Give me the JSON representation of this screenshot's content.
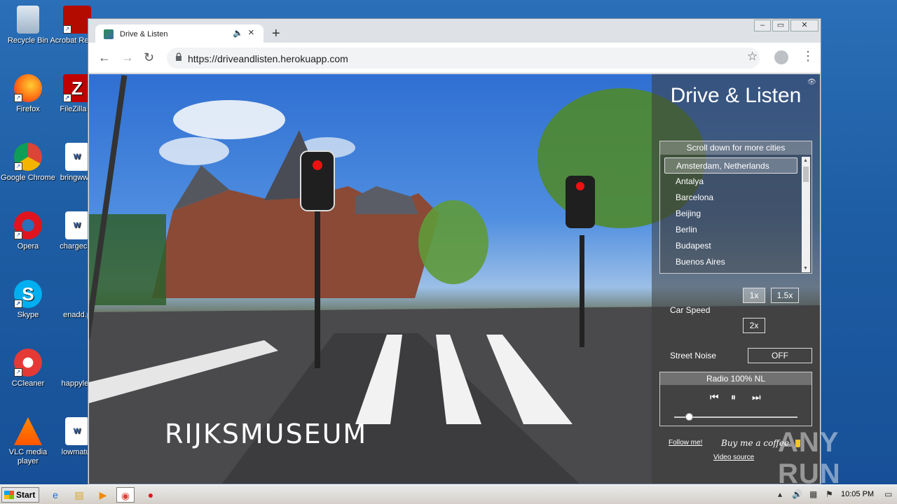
{
  "desktop": {
    "icons": [
      {
        "label": "Recycle Bin"
      },
      {
        "label": "Acrobat Reader"
      },
      {
        "label": "Firefox"
      },
      {
        "label": "FileZilla C"
      },
      {
        "label": "Google Chrome"
      },
      {
        "label": "bringwww"
      },
      {
        "label": "Opera"
      },
      {
        "label": "chargecivi"
      },
      {
        "label": "Skype"
      },
      {
        "label": "enadd.p"
      },
      {
        "label": "CCleaner"
      },
      {
        "label": "happylea"
      },
      {
        "label": "VLC media player"
      },
      {
        "label": "lowmatur"
      }
    ]
  },
  "browser": {
    "tab_title": "Drive & Listen",
    "url": "https://driveandlisten.herokuapp.com"
  },
  "scene": {
    "caption": "RIJKSMUSEUM"
  },
  "app": {
    "title": "Drive & Listen",
    "city_header": "Scroll down for more cities",
    "cities": [
      "Amsterdam, Netherlands",
      "Antalya",
      "Barcelona",
      "Beijing",
      "Berlin",
      "Budapest",
      "Buenos Aires"
    ],
    "speed_options": [
      "1x",
      "1.5x",
      "2x"
    ],
    "car_speed_label": "Car Speed",
    "street_noise_label": "Street Noise",
    "street_noise_value": "OFF",
    "radio_name": "Radio 100% NL",
    "volume": 0.12,
    "follow_label": "Follow me!",
    "coffee_label": "Buy me a coffee",
    "video_source_label": "Video source"
  },
  "watermark": "ANY RUN",
  "taskbar": {
    "start_label": "Start",
    "clock": "10:05 PM"
  }
}
